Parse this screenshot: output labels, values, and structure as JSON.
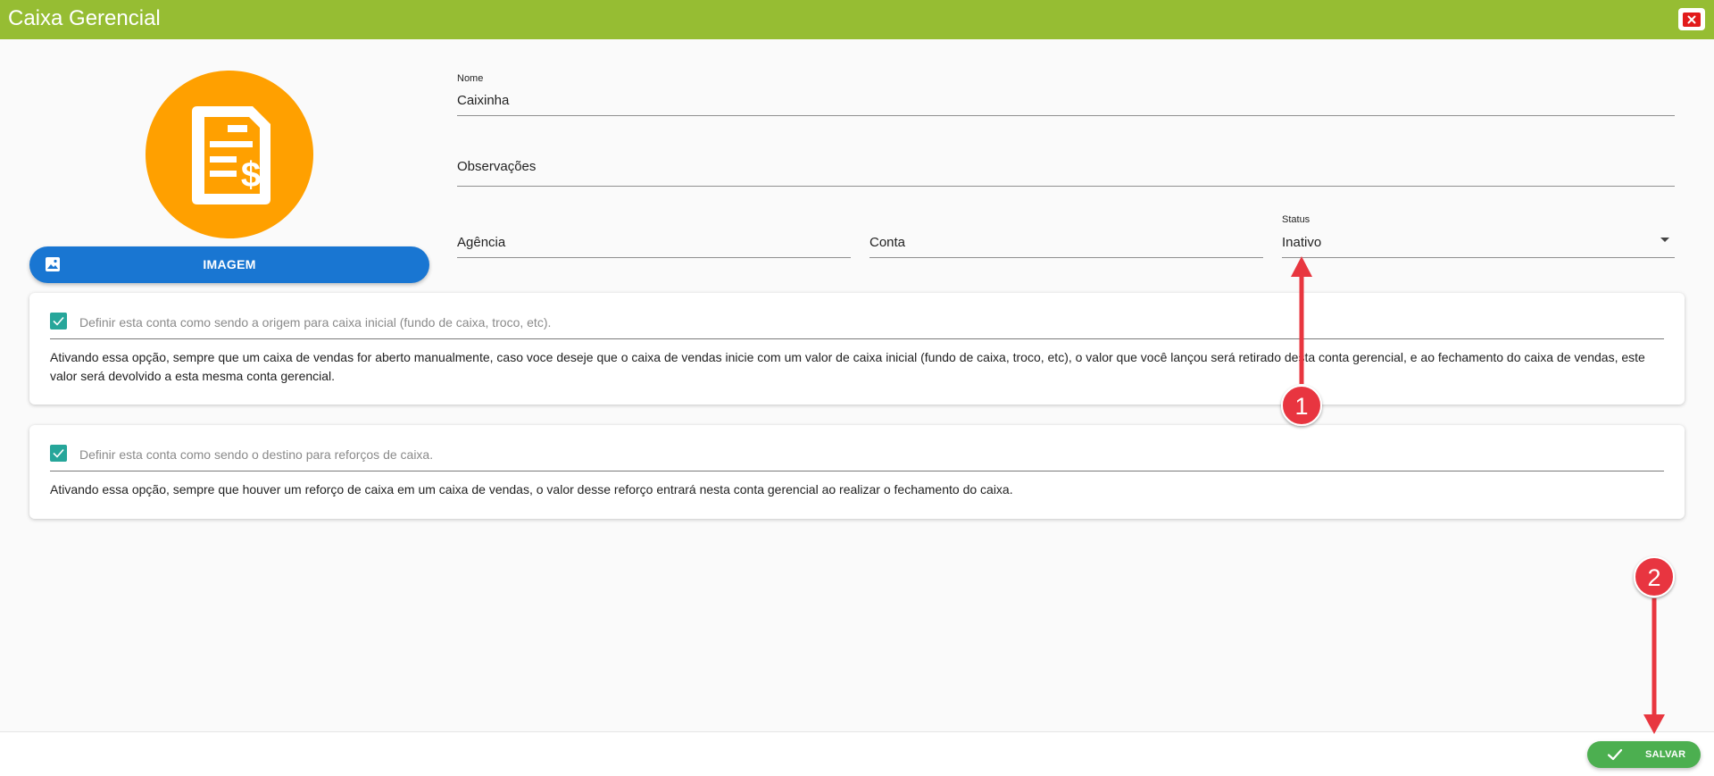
{
  "window": {
    "title": "Caixa Gerencial"
  },
  "icons": {
    "close": "close-icon",
    "avatar": "invoice-dollar-icon",
    "image": "image-icon",
    "save": "checkmark-icon",
    "dropdown": "caret-down-icon"
  },
  "image_button": {
    "label": "IMAGEM"
  },
  "form": {
    "nome": {
      "label": "Nome",
      "value": "Caixinha"
    },
    "observacoes": {
      "placeholder": "Observações"
    },
    "agencia": {
      "placeholder": "Agência"
    },
    "conta": {
      "placeholder": "Conta"
    },
    "status": {
      "label": "Status",
      "value": "Inativo"
    }
  },
  "options": [
    {
      "checked": true,
      "label": "Definir esta conta como sendo a origem para caixa inicial (fundo de caixa, troco, etc).",
      "description": "Ativando essa opção, sempre que um caixa de vendas for aberto manualmente, caso voce deseje que o caixa de vendas inicie com um valor de caixa inicial (fundo de caixa, troco, etc), o valor que você lançou será retirado desta conta gerencial, e ao fechamento do caixa de vendas, este valor será devolvido a esta mesma conta gerencial."
    },
    {
      "checked": true,
      "label": "Definir esta conta como sendo o destino para reforços de caixa.",
      "description": "Ativando essa opção, sempre que houver um reforço de caixa em um caixa de vendas, o valor desse reforço entrará nesta conta gerencial ao realizar o fechamento do caixa."
    }
  ],
  "footer": {
    "save_label": "SALVAR"
  },
  "annotations": [
    {
      "number": "1"
    },
    {
      "number": "2"
    }
  ],
  "colors": {
    "titlebar": "#96bd33",
    "avatar": "#ffa000",
    "image_button": "#1976d2",
    "checkbox": "#26a69a",
    "save_button": "#4caf50",
    "annotation": "#e8363f",
    "close": "#e21b1b"
  }
}
